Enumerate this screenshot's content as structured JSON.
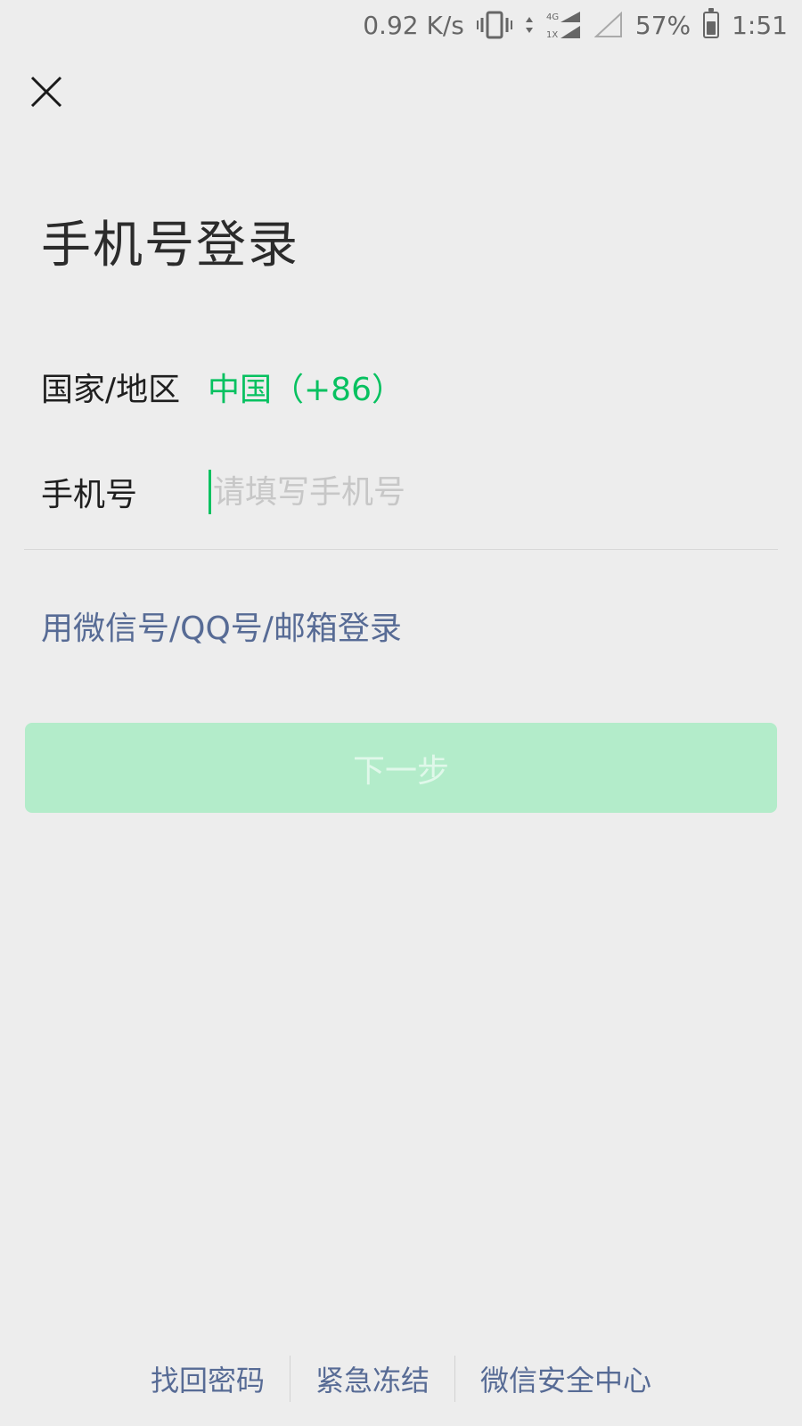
{
  "status_bar": {
    "speed": "0.92 K/s",
    "battery_percent": "57%",
    "battery_level": 0.57,
    "time": "1:51",
    "icons": [
      "vibrate-icon",
      "data-arrows-icon",
      "signal-4g-1x-icon",
      "signal-empty-icon",
      "battery-icon"
    ]
  },
  "header": {
    "close_icon": "close-icon"
  },
  "title": "手机号登录",
  "form": {
    "country_label": "国家/地区",
    "country_value": "中国（+86）",
    "phone_label": "手机号",
    "phone_value": "",
    "phone_placeholder": "请填写手机号"
  },
  "alt_login": "用微信号/QQ号/邮箱登录",
  "next_button": "下一步",
  "footer": {
    "links": [
      "找回密码",
      "紧急冻结",
      "微信安全中心"
    ]
  },
  "colors": {
    "accent_green": "#07c160",
    "link_blue": "#576b95",
    "button_disabled_bg": "#b3ecca",
    "background": "#ededed"
  }
}
